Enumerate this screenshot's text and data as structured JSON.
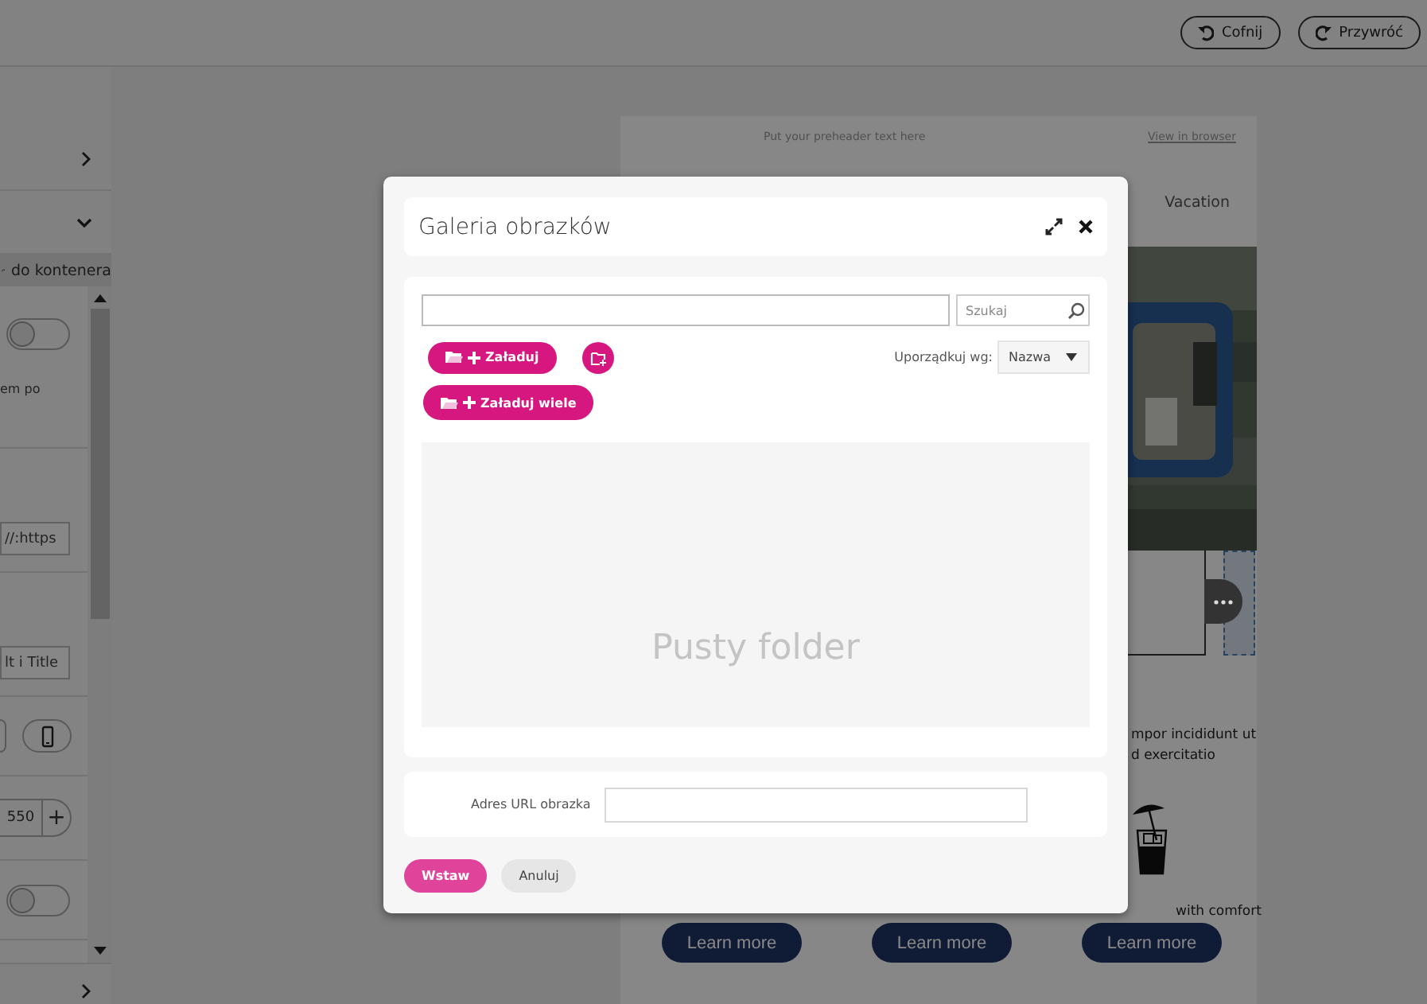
{
  "top_bar": {
    "buttons": [
      "Cofnij",
      "Przywróć"
    ]
  },
  "sidebar": {
    "sections": [
      {
        "kind": "collapsed"
      },
      {
        "kind": "expanded"
      }
    ],
    "container_bar": "do kontenera",
    "controls": [
      {
        "kind": "toggle",
        "on": false
      },
      {
        "kind": "text",
        "text": "em po"
      },
      {
        "kind": "input",
        "value": "//:https"
      },
      {
        "kind": "input",
        "value": "lt i Title"
      },
      {
        "kind": "devices"
      },
      {
        "kind": "stepper",
        "value": "550",
        "plus": "+"
      },
      {
        "kind": "toggle",
        "on": false
      }
    ]
  },
  "email": {
    "preheader": "Put your preheader text here",
    "view_in_browser": "View in browser",
    "header_title": "Vacation",
    "text_lines": [
      "mpor incididunt ut",
      "d exercitatio"
    ],
    "caption": "with comfort",
    "buttons": [
      "Learn more",
      "Learn more",
      "Learn more"
    ]
  },
  "modal": {
    "title": "Galeria obrazków",
    "search_placeholder": "Szukaj",
    "upload_buttons": [
      "Załaduj",
      "Załaduj wiele"
    ],
    "sort_label": "Uporządkuj wg:",
    "sort_value": "Nazwa",
    "empty_text": "Pusty folder",
    "url_label": "Adres URL obrazka",
    "actions": [
      {
        "label": "Wstaw",
        "kind": "primary"
      },
      {
        "label": "Anuluj",
        "kind": "secondary"
      }
    ]
  }
}
